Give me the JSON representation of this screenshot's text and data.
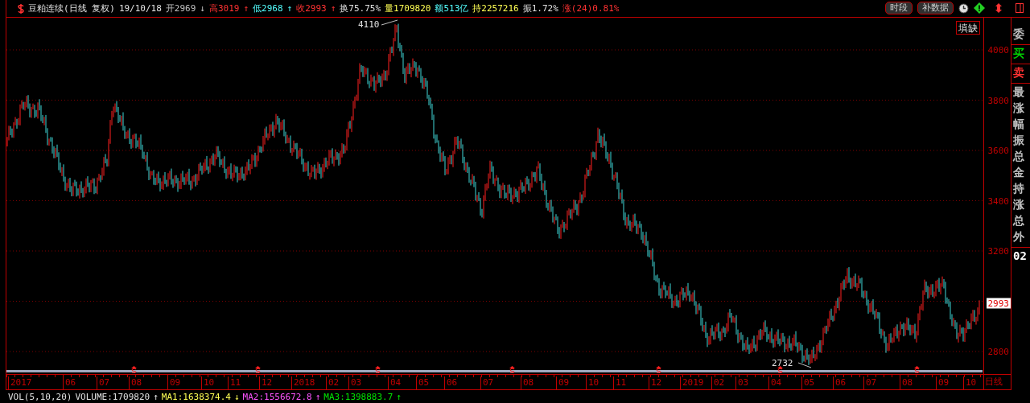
{
  "header": {
    "title": "豆粕连续(日线 复权)",
    "date": "19/10/18",
    "quotes": [
      {
        "text": "开2969",
        "arrow": "↓",
        "color": "#c0c0c0"
      },
      {
        "text": "高3019",
        "arrow": "↑",
        "color": "#ff3232"
      },
      {
        "text": "低2968",
        "arrow": "↑",
        "color": "#54ffff"
      },
      {
        "text": "收2993",
        "arrow": "↑",
        "color": "#ff3232"
      },
      {
        "text": "换75.75%",
        "color": "#e0e0e0"
      },
      {
        "text": "量1709820",
        "color": "#ffff54"
      },
      {
        "text": "额513亿",
        "color": "#54ffff"
      },
      {
        "text": "持2257216",
        "color": "#ffff54"
      },
      {
        "text": "振1.72%",
        "color": "#e0e0e0"
      },
      {
        "text": "涨(24)0.81%",
        "color": "#ff3232"
      }
    ],
    "buttons": [
      "时段",
      "补数据"
    ]
  },
  "chart": {
    "fill_button": "填缺",
    "high_label": "4110",
    "low_label": "2732",
    "last_price": "2993",
    "yticks": [
      "4000",
      "3800",
      "3600",
      "3400",
      "3200",
      "2800"
    ],
    "xlabels": [
      "2017",
      "06",
      "07",
      "08",
      "09",
      "10",
      "11",
      "12",
      "2018",
      "02",
      "03",
      "04",
      "05",
      "06",
      "07",
      "08",
      "09",
      "10",
      "11",
      "12",
      "2019",
      "02",
      "03",
      "04",
      "05",
      "06",
      "07",
      "08",
      "09",
      "10"
    ],
    "period": "日线"
  },
  "side_panel": [
    {
      "text": "委",
      "color": "#c0c0c0"
    },
    {
      "text": "买",
      "color": "#00d000"
    },
    {
      "text": "卖",
      "color": "#ff3232"
    },
    {
      "text": "最",
      "color": "#c0c0c0"
    },
    {
      "text": "涨",
      "color": "#c0c0c0"
    },
    {
      "text": "幅",
      "color": "#c0c0c0"
    },
    {
      "text": "振",
      "color": "#c0c0c0"
    },
    {
      "text": "总",
      "color": "#c0c0c0"
    },
    {
      "text": "金",
      "color": "#c0c0c0"
    },
    {
      "text": "持",
      "color": "#c0c0c0"
    },
    {
      "text": "涨",
      "color": "#c0c0c0"
    },
    {
      "text": "总",
      "color": "#c0c0c0"
    },
    {
      "text": "外",
      "color": "#c0c0c0"
    },
    {
      "text": "02",
      "color": "#ffffff"
    }
  ],
  "volume": {
    "title": "VOL(5,10,20)",
    "items": [
      {
        "text": "VOLUME:1709820",
        "arrow": "↑",
        "color": "#e0e0e0"
      },
      {
        "text": "MA1:1638374.4",
        "arrow": "↓",
        "color": "#ffff54"
      },
      {
        "text": "MA2:1556672.8",
        "arrow": "↑",
        "color": "#ff54ff"
      },
      {
        "text": "MA3:1398883.7",
        "arrow": "↑",
        "color": "#00e600"
      }
    ]
  }
}
